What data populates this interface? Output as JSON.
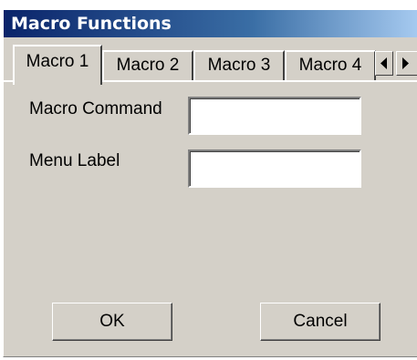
{
  "window": {
    "title": "Macro Functions"
  },
  "tabs": [
    {
      "label": "Macro 1",
      "active": true
    },
    {
      "label": "Macro 2",
      "active": false
    },
    {
      "label": "Macro 3",
      "active": false
    },
    {
      "label": "Macro 4",
      "active": false
    }
  ],
  "tab_scroll": {
    "left_icon": "triangle-left-icon",
    "right_icon": "triangle-right-icon"
  },
  "form": {
    "macro_command_label": "Macro Command",
    "macro_command_value": "",
    "menu_label_label": "Menu Label",
    "menu_label_value": ""
  },
  "buttons": {
    "ok_label": "OK",
    "cancel_label": "Cancel"
  },
  "colors": {
    "titlebar_start": "#0a246a",
    "titlebar_end": "#a6caf0",
    "face": "#d4d0c8"
  }
}
